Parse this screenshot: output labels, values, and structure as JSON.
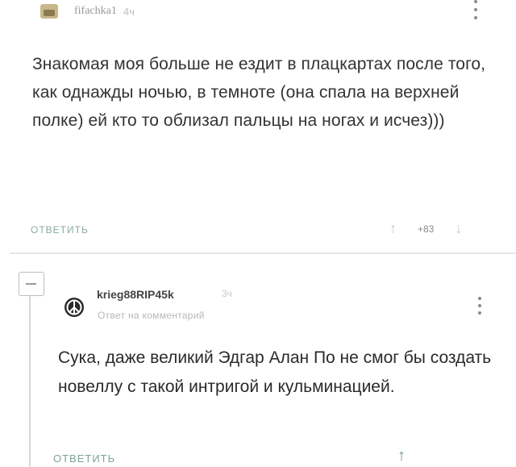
{
  "comment": {
    "username": "fifachka1",
    "time": "4ч",
    "text": "Знакомая моя больше не ездит в плацкартах после того, как однажды ночью, в темноте (она спала на верхней полке) ей кто то облизал пальцы на ногах и исчез)))",
    "reply_label": "ОТВЕТИТЬ",
    "rating": "+83",
    "icons": {
      "up": "arrow-up-icon",
      "down": "arrow-down-icon",
      "more": "more-vertical-icon"
    }
  },
  "reply": {
    "username": "krieg88RIP45k",
    "time": "3ч",
    "context": "Ответ на комментарий",
    "text": "Сука, даже великий Эдгар Алан По не смог бы создать новеллу с такой интригой и кульминацией.",
    "reply_label": "ОТВЕТИТЬ",
    "icons": {
      "avatar": "peace-symbol-icon",
      "collapse": "collapse-minus-icon",
      "up": "arrow-up-icon"
    }
  },
  "colors": {
    "reply_link": "#7fa394",
    "text": "#2f2f2f",
    "muted": "#b8b8b8"
  }
}
